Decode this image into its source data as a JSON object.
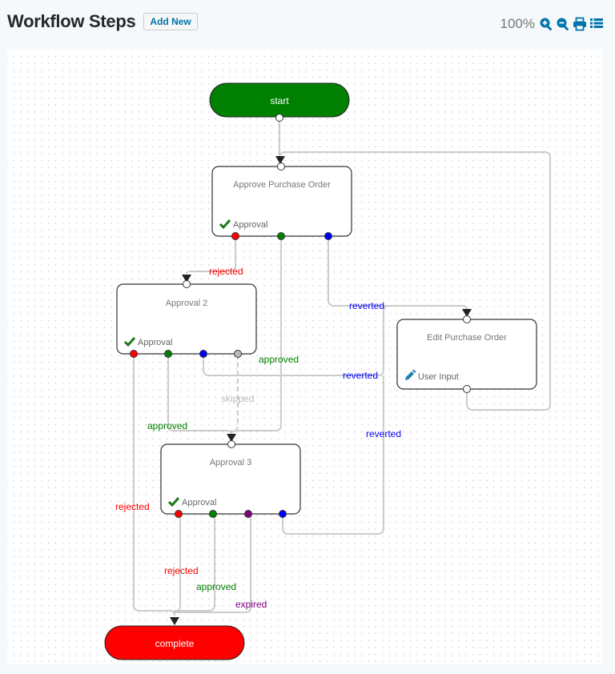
{
  "header": {
    "title": "Workflow Steps",
    "add_new_label": "Add New"
  },
  "toolbar": {
    "zoom_level": "100%",
    "icons": [
      "zoom-in-icon",
      "zoom-out-icon",
      "print-icon",
      "list-icon"
    ]
  },
  "colors": {
    "start": "#008000",
    "complete": "#ff0000",
    "rejected": "#ff0000",
    "approved": "#008000",
    "reverted": "#0000ff",
    "skipped": "#bbbbbb",
    "expired": "#800080",
    "accent": "#0073aa"
  },
  "diagram": {
    "start": {
      "label": "start"
    },
    "complete": {
      "label": "complete"
    },
    "steps": [
      {
        "id": "approve-po",
        "title": "Approve Purchase Order",
        "type": "Approval",
        "type_icon": "checkmark-icon"
      },
      {
        "id": "approval-2",
        "title": "Approval 2",
        "type": "Approval",
        "type_icon": "checkmark-icon"
      },
      {
        "id": "edit-po",
        "title": "Edit Purchase Order",
        "type": "User Input",
        "type_icon": "pencil-icon"
      },
      {
        "id": "approval-3",
        "title": "Approval 3",
        "type": "Approval",
        "type_icon": "checkmark-icon"
      }
    ],
    "edge_labels": {
      "apo_rejected": "rejected",
      "apo_approved": "approved",
      "apo_reverted": "reverted",
      "a2_rejected": "rejected",
      "a2_approved": "approved",
      "a2_reverted": "reverted",
      "a2_skipped": "skipped",
      "a3_rejected": "rejected",
      "a3_approved": "approved",
      "a3_expired": "expired",
      "a3_reverted": "reverted"
    }
  }
}
